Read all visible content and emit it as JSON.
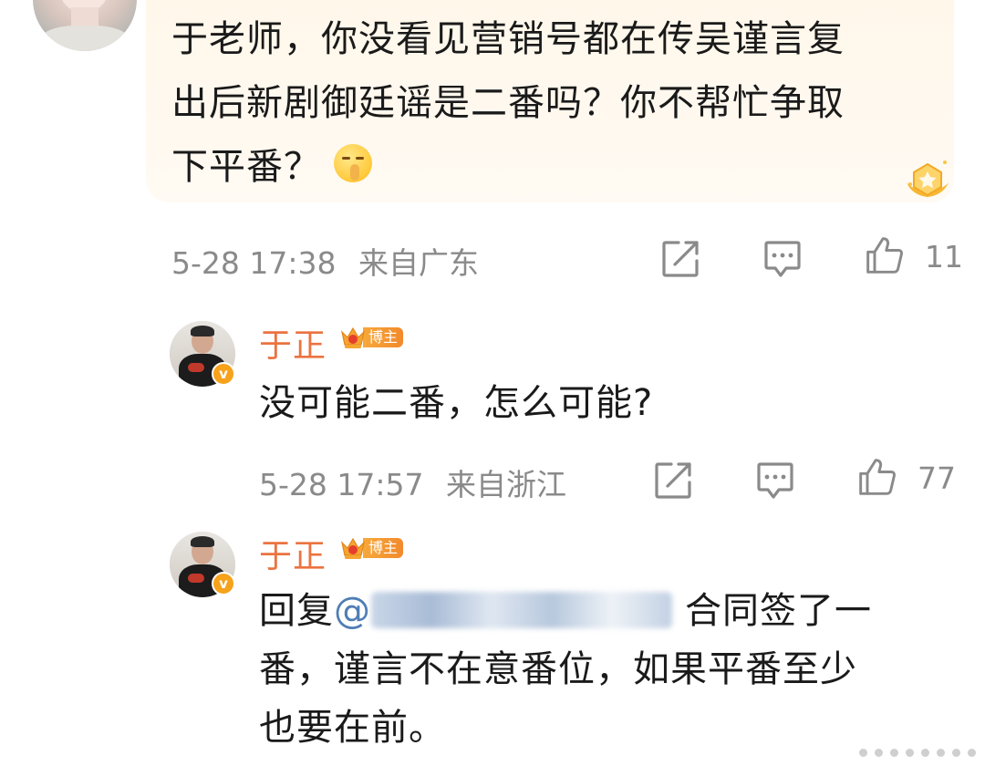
{
  "comment": {
    "text": "于老师，你没看见营销号都在传吴谨言复出后新剧御廷谣是二番吗？你不帮忙争取下平番？",
    "line1": "于老师，你没看见营销号都在传吴谨言复",
    "line2": "出后新剧御廷谣是二番吗？你不帮忙争取",
    "line3": "下平番？",
    "timestamp": "5-28 17:38",
    "location": "来自广东",
    "likes": "11",
    "emoji": "shush-emoji"
  },
  "replies": [
    {
      "name": "于正",
      "badge": "博主",
      "text": "没可能二番，怎么可能?",
      "timestamp": "5-28 17:57",
      "location": "来自浙江",
      "likes": "77"
    },
    {
      "name": "于正",
      "badge": "博主",
      "prefix": "回复",
      "mention": "@",
      "line1_tail": "合同签了一",
      "line2": "番，谨言不在意番位，如果平番至少",
      "line3": "也要在前。"
    }
  ],
  "icons": {
    "share": "share-icon",
    "comment": "comment-icon",
    "like": "thumbs-up-icon",
    "verified": "verified-v-icon",
    "crown": "crown-icon",
    "medal": "star-medal-icon"
  },
  "colors": {
    "name": "#eb7340",
    "meta": "#8a8a8a",
    "mention": "#4f7db5",
    "bubble": "#fff8ed",
    "badge": "#f7a21b"
  }
}
